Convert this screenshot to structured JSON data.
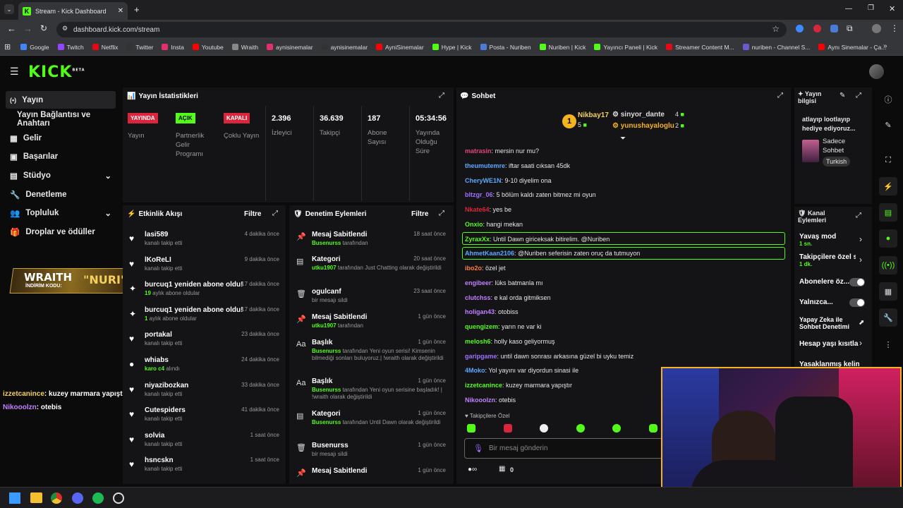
{
  "browser": {
    "tab_title": "Stream - Kick Dashboard",
    "url": "dashboard.kick.com/stream",
    "bookmarks": [
      {
        "label": "Google",
        "color": "#4285f4"
      },
      {
        "label": "Twitch",
        "color": "#9146ff"
      },
      {
        "label": "Netflix",
        "color": "#e50914"
      },
      {
        "label": "Twitter",
        "color": "#333333"
      },
      {
        "label": "Insta",
        "color": "#e1306c"
      },
      {
        "label": "Youtube",
        "color": "#ff0000"
      },
      {
        "label": "Wraith",
        "color": "#888888"
      },
      {
        "label": "aynisinemalar",
        "color": "#e1306c"
      },
      {
        "label": "aynisinemalar",
        "color": "#333333"
      },
      {
        "label": "AyniSinemalar",
        "color": "#ff0000"
      },
      {
        "label": "Hype | Kick",
        "color": "#53fc18"
      },
      {
        "label": "Posta - Nuriben",
        "color": "#4a7bd6"
      },
      {
        "label": "Nuriben | Kick",
        "color": "#53fc18"
      },
      {
        "label": "Yayıncı Paneli | Kick",
        "color": "#53fc18"
      },
      {
        "label": "Streamer Content M...",
        "color": "#e50914"
      },
      {
        "label": "nuriben - Channel S...",
        "color": "#6a5acd"
      },
      {
        "label": "Aynı Sinemalar - Ça...",
        "color": "#ff0000"
      }
    ]
  },
  "header": {
    "logo": "KICK",
    "logo_sup": "BETA"
  },
  "sidebar": [
    {
      "label": "Yayın",
      "icon": "broadcast-icon"
    },
    {
      "label": "Yayın Bağlantısı ve Anahtarı"
    },
    {
      "label": "Gelir",
      "icon": "revenue-icon"
    },
    {
      "label": "Başarılar",
      "icon": "achievements-icon"
    },
    {
      "label": "Stüdyo",
      "icon": "studio-icon"
    },
    {
      "label": "Denetleme",
      "icon": "wrench-icon"
    },
    {
      "label": "Topluluk",
      "icon": "community-icon"
    },
    {
      "label": "Droplar ve ödüller",
      "icon": "gift-icon"
    }
  ],
  "overlay": {
    "brand": "WRAITH",
    "code_label": "İNDİRİM KODU:",
    "code": "NURI",
    "chat": [
      {
        "user": "izzetcanince",
        "msg": ": kuzey marmara yapıştır"
      },
      {
        "user": "Nikooolzn",
        "msg": ": otebis"
      }
    ]
  },
  "stats": {
    "title": "Yayın İstatistikleri",
    "items": [
      {
        "badge": "YAYINDA",
        "badge_color": "#d9263c",
        "label": "Yayın"
      },
      {
        "badge": "AÇIK",
        "badge_color": "#53fc18",
        "label": "Partnerlik Gelir Programı"
      },
      {
        "badge": "KAPALI",
        "badge_color": "#d9263c",
        "label": "Çoklu Yayın"
      },
      {
        "value": "2.396",
        "label": "İzleyici"
      },
      {
        "value": "36.639",
        "label": "Takipçi"
      },
      {
        "value": "187",
        "label": "Abone Sayısı"
      },
      {
        "value": "05:34:56",
        "label": "Yayında Olduğu Süre"
      }
    ]
  },
  "activity": {
    "title": "Etkinlik Akışı",
    "filter": "Filtre",
    "items": [
      {
        "name": "lasi589",
        "sub": "kanalı takip etti",
        "time": "4 dakika önce",
        "icon": "♥"
      },
      {
        "name": "lKoReLI",
        "sub": "kanalı takip etti",
        "time": "9 dakika önce",
        "icon": "♥"
      },
      {
        "name": "burcuq1 yeniden abone oldu!",
        "sub_num": "19",
        "sub": " aylık abone oldular",
        "time": "17 dakika önce",
        "icon": "✦"
      },
      {
        "name": "burcuq1 yeniden abone oldu!",
        "sub_num": "1",
        "sub": " aylık abone oldular",
        "time": "17 dakika önce",
        "icon": "✦"
      },
      {
        "name": "portakal",
        "sub": "kanalı takip etti",
        "time": "23 dakika önce",
        "icon": "♥"
      },
      {
        "name": "whiabs",
        "sub_num": "karo c4",
        "sub": " alındı",
        "time": "24 dakika önce",
        "icon": "●"
      },
      {
        "name": "niyazibozkan",
        "sub": "kanalı takip etti",
        "time": "33 dakika önce",
        "icon": "♥"
      },
      {
        "name": "Cutespiders",
        "sub": "kanalı takip etti",
        "time": "41 dakika önce",
        "icon": "♥"
      },
      {
        "name": "solvia",
        "sub": "kanalı takip etti",
        "time": "1 saat önce",
        "icon": "♥"
      },
      {
        "name": "hsncskn",
        "sub": "kanalı takip etti",
        "time": "1 saat önce",
        "icon": "♥"
      }
    ]
  },
  "moderation": {
    "title": "Denetim Eylemleri",
    "filter": "Filtre",
    "items": [
      {
        "name": "Mesaj Sabitlendi",
        "user": "Busenurss",
        "rest": " tarafından",
        "time": "18 saat önce",
        "icon": "📌"
      },
      {
        "name": "Kategori",
        "user": "utku1907",
        "rest": " tarafından Just Chatting olarak değiştirildi",
        "time": "20 saat önce",
        "icon": "▤"
      },
      {
        "name": "ogulcanf",
        "user": "",
        "rest": "bir mesajı sildi",
        "time": "23 saat önce",
        "icon": "🗑"
      },
      {
        "name": "Mesaj Sabitlendi",
        "user": "utku1907",
        "rest": " tarafından",
        "time": "1 gün önce",
        "icon": "📌"
      },
      {
        "name": "Başlık",
        "user": "Busenurss",
        "rest": " tarafından Yeni oyun serisi! Kimsenin bilmediği sonları buluyoruz.| !wraith olarak değiştirildi",
        "time": "1 gün önce",
        "icon": "Aa"
      },
      {
        "name": "Başlık",
        "user": "Busenurss",
        "rest": " tarafından Yeni oyun serisine başladık! | !wraith olarak değiştirildi",
        "time": "1 gün önce",
        "icon": "Aa"
      },
      {
        "name": "Kategori",
        "user": "Busenurss",
        "rest": " tarafından Until Dawn olarak değiştirildi",
        "time": "1 gün önce",
        "icon": "▤"
      },
      {
        "name": "Busenurss",
        "user": "",
        "rest": "bir mesajı sildi",
        "time": "1 gün önce",
        "icon": "🗑"
      },
      {
        "name": "Mesaj Sabitlendi",
        "user": "",
        "rest": "",
        "time": "1 gün önce",
        "icon": "📌"
      }
    ]
  },
  "chat": {
    "title": "Sohbet",
    "leaders": [
      {
        "name": "Nikbay17",
        "count": "5"
      },
      {
        "name": "sinyor_dante",
        "count": "4"
      },
      {
        "name": "yunushayaloglu",
        "count": "2"
      }
    ],
    "messages": [
      {
        "user": "matrasin",
        "color": "#e0457b",
        "msg": ": mersin nur mu?"
      },
      {
        "user": "theumutemre",
        "color": "#5ca8ff",
        "msg": ": iftar saati cıksan 45dk"
      },
      {
        "user": "CheryWE1N",
        "color": "#5ca8ff",
        "msg": ": 9-10 diyelim ona"
      },
      {
        "user": "bltzgr_06",
        "color": "#a070ff",
        "msg": ": 5 bölüm kaldı zaten bitmez mi oyun"
      },
      {
        "user": "Nkate64",
        "color": "#d9263c",
        "msg": ": yes be"
      },
      {
        "user": "Onxio",
        "color": "#53fc18",
        "msg": ": hangi mekan"
      },
      {
        "user": "ZyraxXx",
        "color": "#53fc18",
        "msg": ": Until Dawn giriceksak bitirelim. @Nuriben"
      },
      {
        "user": "AhmetKaan2106",
        "color": "#5ca8ff",
        "msg": ": @Nuriben seferisin zaten oruç da tutmuyon"
      },
      {
        "user": "ibo2o",
        "color": "#ff7a45",
        "msg": ": özel jet"
      },
      {
        "user": "engibeer",
        "color": "#c080ff",
        "msg": ": lüks batmanla mı"
      },
      {
        "user": "clutchss",
        "color": "#c080ff",
        "msg": ": e kal orda gitmiksen"
      },
      {
        "user": "holigan43",
        "color": "#c080ff",
        "msg": ": otobiss"
      },
      {
        "user": "quengizem",
        "color": "#53fc18",
        "msg": ": yarın ne var ki"
      },
      {
        "user": "melosh6",
        "color": "#53fc18",
        "msg": ": holly kaso geliyormuş"
      },
      {
        "user": "garipgame",
        "color": "#a070ff",
        "msg": ": until dawn sonrası arkasına güzel bi uyku temiz"
      },
      {
        "user": "4Moko",
        "color": "#5ca8ff",
        "msg": ": Yol yayını var diyordun sinasi ile"
      },
      {
        "user": "izzetcanince",
        "color": "#53fc18",
        "msg": ": kuzey marmara yapıştır"
      },
      {
        "user": "Nikooolzn",
        "color": "#c080ff",
        "msg": ": otebis"
      }
    ],
    "followers_only": "Takipçilere Özel",
    "placeholder": "Bir mesaj gönderin",
    "count": "0"
  },
  "stream_info": {
    "title": "Yayın bilgisi",
    "stream_title": "atlayıp lootlayıp hediye ediyoruz...",
    "category": "Sadece Sohbet",
    "language": "Turkish"
  },
  "channel_actions": {
    "title": "Kanal Eylemleri",
    "items": [
      {
        "label": "Yavaş mod",
        "sub": "1 sn."
      },
      {
        "label": "Takipçilere özel s",
        "sub": "1 dk."
      },
      {
        "label": "Abonelere öz..."
      },
      {
        "label": "Yalnızca..."
      },
      {
        "label": "Yapay Zeka ile Sohbet Denetimi"
      },
      {
        "label": "Hesap yaşı kısıtla"
      },
      {
        "label": "Yasaklanmış kelin"
      }
    ]
  }
}
